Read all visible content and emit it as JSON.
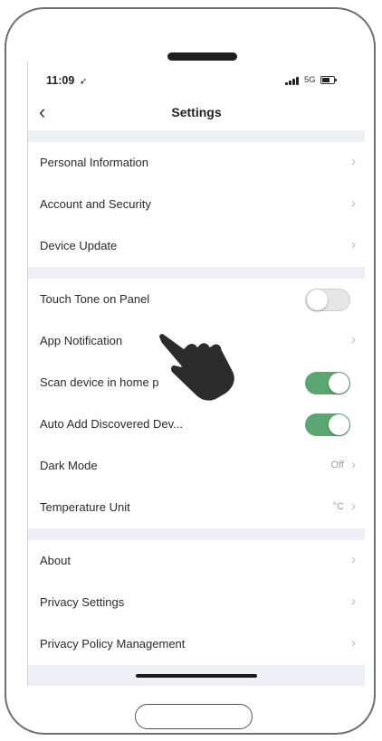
{
  "status_bar": {
    "time": "11:09",
    "location_glyph": "➶",
    "network": "5G"
  },
  "nav": {
    "back_glyph": "‹",
    "title": "Settings"
  },
  "chevron": "›",
  "sections": [
    {
      "rows": [
        {
          "label": "Personal Information",
          "type": "link"
        },
        {
          "label": "Account and Security",
          "type": "link"
        },
        {
          "label": "Device Update",
          "type": "link"
        }
      ]
    },
    {
      "rows": [
        {
          "label": "Touch Tone on Panel",
          "type": "toggle",
          "on": false
        },
        {
          "label": "App Notification",
          "type": "link"
        },
        {
          "label": "Scan device in home p",
          "type": "toggle",
          "on": true
        },
        {
          "label": "Auto Add Discovered Dev...",
          "type": "toggle",
          "on": true
        },
        {
          "label": "Dark Mode",
          "type": "link",
          "value": "Off"
        },
        {
          "label": "Temperature Unit",
          "type": "link",
          "value": "°C"
        }
      ]
    },
    {
      "rows": [
        {
          "label": "About",
          "type": "link"
        },
        {
          "label": "Privacy Settings",
          "type": "link"
        },
        {
          "label": "Privacy Policy Management",
          "type": "link"
        }
      ]
    }
  ],
  "icons": {
    "pointer": "hand-pointer-icon",
    "battery": "battery-icon",
    "signal": "signal-bars-icon"
  },
  "colors": {
    "toggle_on": "#5aa673",
    "toggle_off": "#e6e6e6",
    "section_gap": "#eef0f6",
    "hand": "#2b2b2b"
  }
}
